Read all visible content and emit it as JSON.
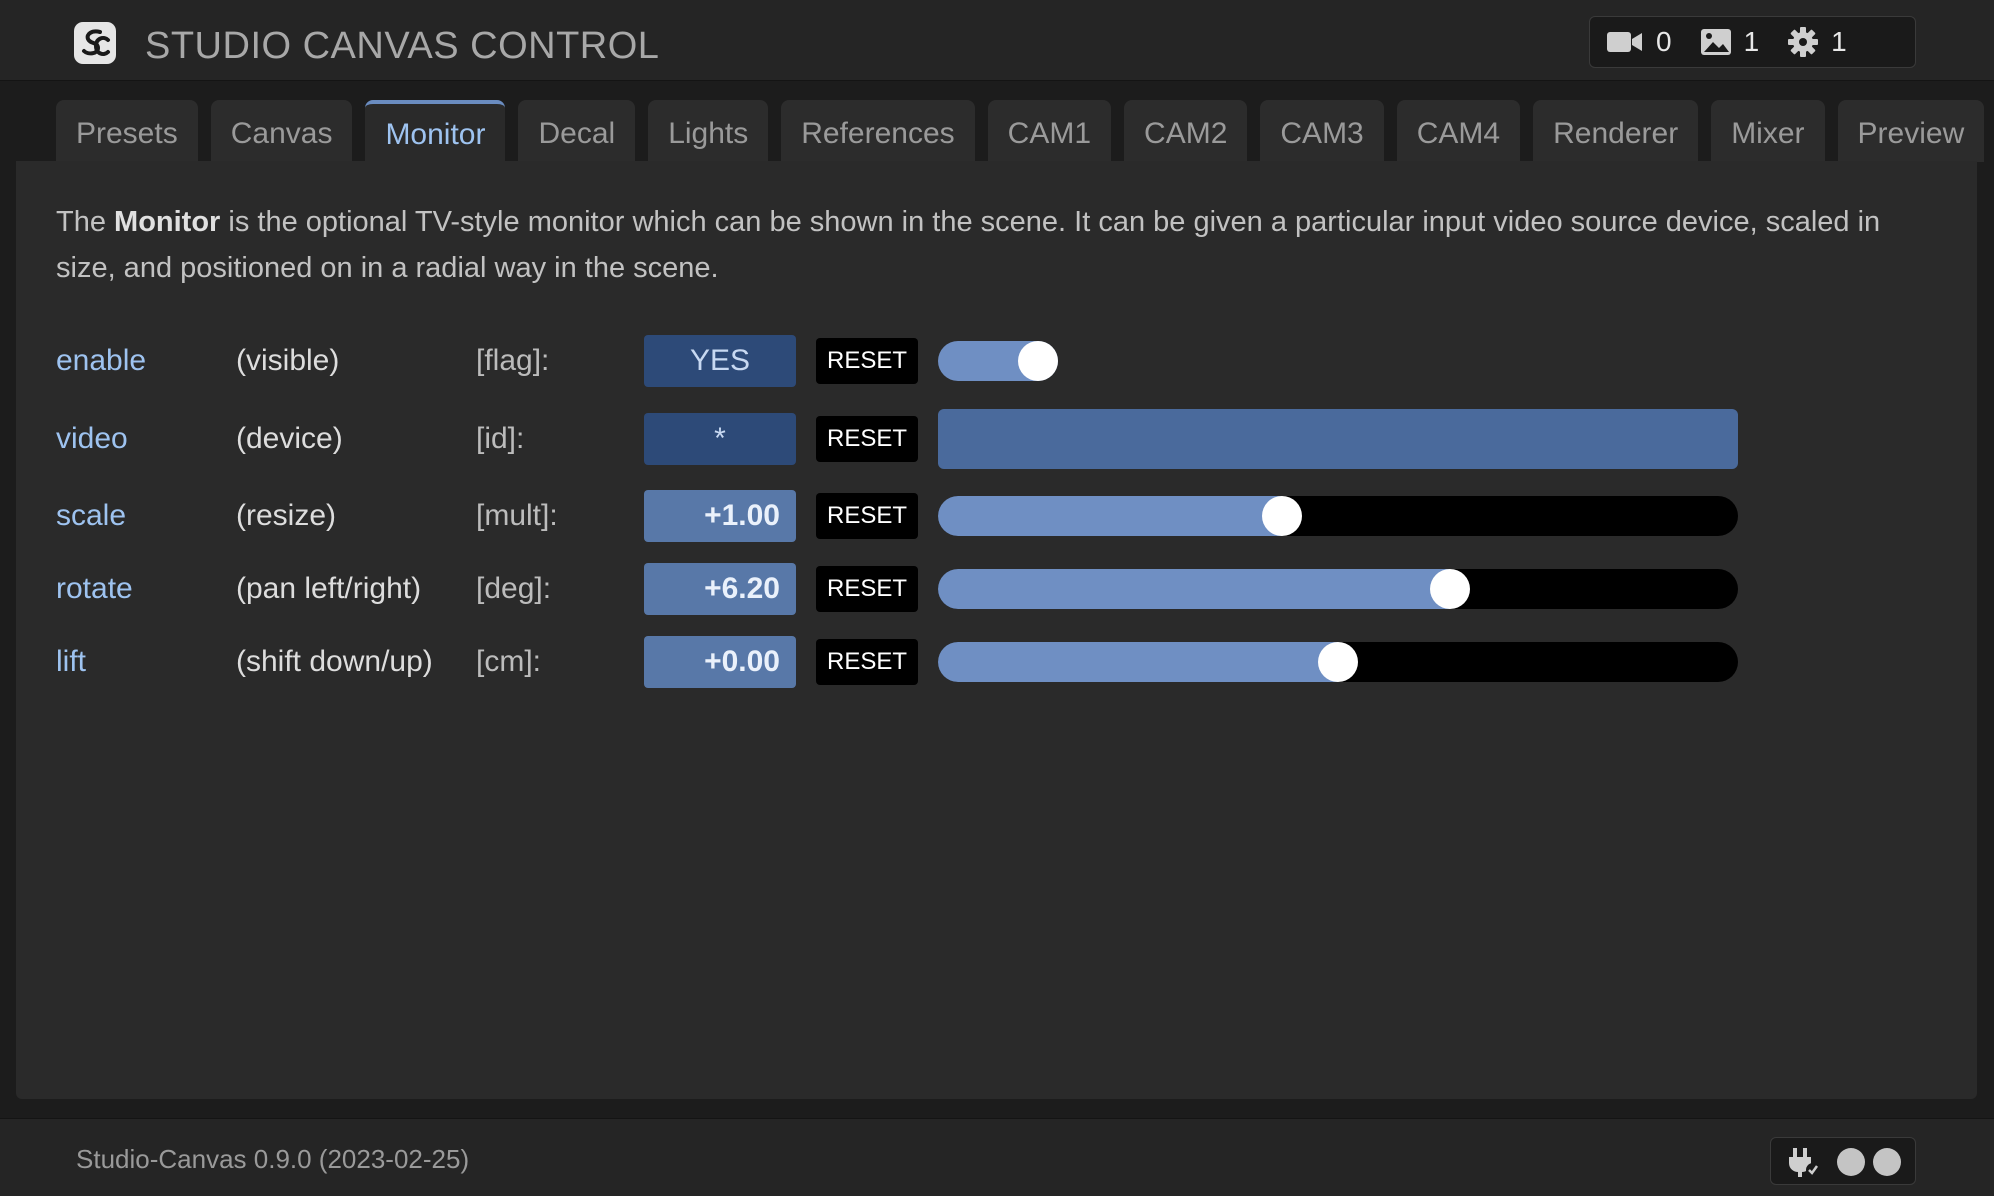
{
  "header": {
    "app_title": "STUDIO CANVAS CONTROL",
    "stats": [
      {
        "icon": "video-camera-icon",
        "value": "0"
      },
      {
        "icon": "image-icon",
        "value": "1"
      },
      {
        "icon": "gear-icon",
        "value": "1"
      }
    ]
  },
  "tabs": [
    "Presets",
    "Canvas",
    "Monitor",
    "Decal",
    "Lights",
    "References",
    "CAM1",
    "CAM2",
    "CAM3",
    "CAM4",
    "Renderer",
    "Mixer",
    "Preview"
  ],
  "active_tab": "Monitor",
  "description": {
    "prefix": "The ",
    "bold": "Monitor",
    "suffix": " is the optional TV-style monitor which can be shown in the scene. It can be given a particular input video source device, scaled in size, and positioned on in a radial way in the scene."
  },
  "params": {
    "enable": {
      "name": "enable",
      "desc": "(visible)",
      "unit": "[flag]:",
      "value": "YES",
      "reset": "RESET",
      "toggle_on": true
    },
    "video": {
      "name": "video",
      "desc": "(device)",
      "unit": "[id]:",
      "value": "*",
      "reset": "RESET",
      "selected": ""
    },
    "scale": {
      "name": "scale",
      "desc": "(resize)",
      "unit": "[mult]:",
      "value": "+1.00",
      "reset": "RESET",
      "slider_fraction": 0.43
    },
    "rotate": {
      "name": "rotate",
      "desc": "(pan left/right)",
      "unit": "[deg]:",
      "value": "+6.20",
      "reset": "RESET",
      "slider_fraction": 0.64
    },
    "lift": {
      "name": "lift",
      "desc": "(shift down/up)",
      "unit": "[cm]:",
      "value": "+0.00",
      "reset": "RESET",
      "slider_fraction": 0.5
    }
  },
  "footer": {
    "version": "Studio-Canvas 0.9.0 (2023-02-25)",
    "status_icons": [
      "plug-check-icon",
      "status-dot",
      "status-dot"
    ]
  },
  "colors": {
    "accent": "#6f8fc3",
    "label": "#9ec3f0",
    "background": "#2a2a2a"
  }
}
